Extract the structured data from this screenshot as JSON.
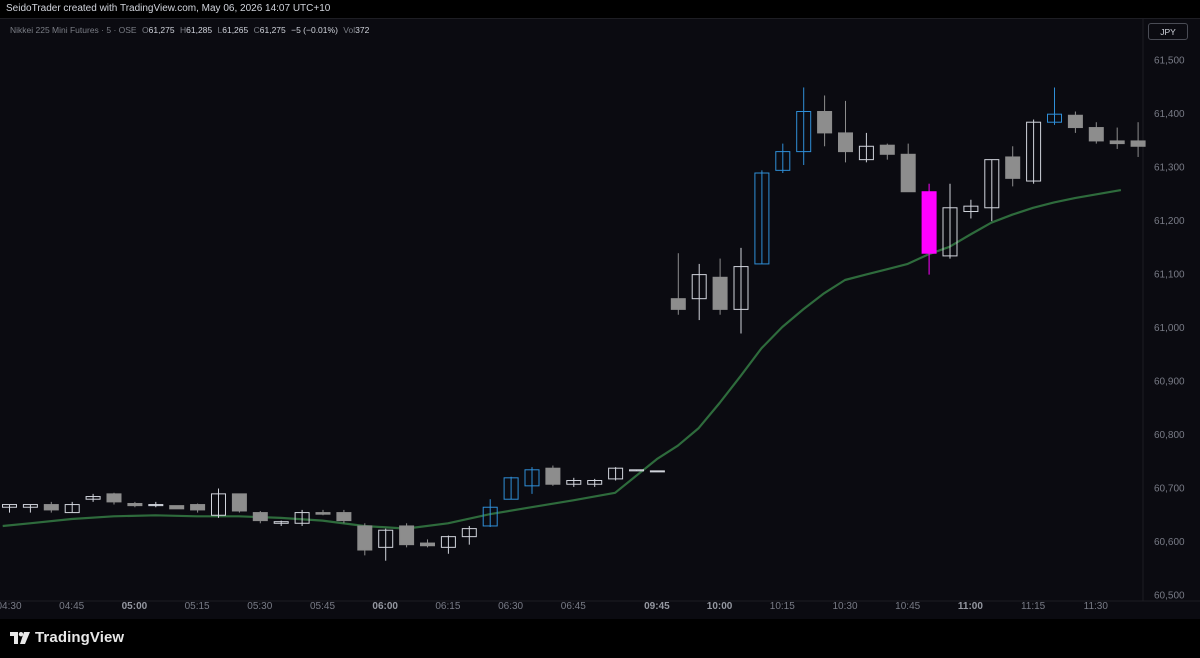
{
  "header": {
    "caption": "SeidoTrader created with TradingView.com, May 06, 2026 14:07 UTC+10"
  },
  "legend": {
    "symbol": "Nikkei 225 Mini Futures · 5 · OSE",
    "o_label": "O",
    "o_value": "61,275",
    "h_label": "H",
    "h_value": "61,285",
    "l_label": "L",
    "l_value": "61,265",
    "c_label": "C",
    "c_value": "61,275",
    "change": "−5 (−0.01%)",
    "vol_label": "Vol",
    "vol_value": "372"
  },
  "currency_button": "JPY",
  "footer": {
    "brand": "TradingView"
  },
  "colors": {
    "background": "#0b0b11",
    "bull_outline": "#d1d4dc",
    "bear_fill": "#8d8d8d",
    "blue_outline": "#2f8fd8",
    "magenta": "#ff00ff",
    "moving_average": "#2e6b3c",
    "axis_text": "#787b86"
  },
  "chart_data": {
    "type": "candlestick",
    "symbol": "Nikkei 225 Mini Futures",
    "interval": "5",
    "exchange": "OSE",
    "y_ticks": [
      61500,
      61400,
      61300,
      61200,
      61100,
      61000,
      60900,
      60800,
      60700,
      60600,
      60500
    ],
    "y_tick_labels": [
      "61,500",
      "61,400",
      "61,300",
      "61,200",
      "61,100",
      "61,000",
      "60,900",
      "60,800",
      "60,700",
      "60,600",
      "60,500"
    ],
    "ylim": [
      60456,
      61578
    ],
    "x_ticks": [
      {
        "label": "04:30",
        "slot": 0,
        "bold": false
      },
      {
        "label": "04:45",
        "slot": 3,
        "bold": false
      },
      {
        "label": "05:00",
        "slot": 6,
        "bold": true
      },
      {
        "label": "05:15",
        "slot": 9,
        "bold": false
      },
      {
        "label": "05:30",
        "slot": 12,
        "bold": false
      },
      {
        "label": "05:45",
        "slot": 15,
        "bold": false
      },
      {
        "label": "06:00",
        "slot": 18,
        "bold": true
      },
      {
        "label": "06:15",
        "slot": 21,
        "bold": false
      },
      {
        "label": "06:30",
        "slot": 24,
        "bold": false
      },
      {
        "label": "06:45",
        "slot": 27,
        "bold": false
      },
      {
        "label": "09:45",
        "slot": 31,
        "bold": true
      },
      {
        "label": "10:00",
        "slot": 34,
        "bold": true
      },
      {
        "label": "10:15",
        "slot": 37,
        "bold": false
      },
      {
        "label": "10:30",
        "slot": 40,
        "bold": false
      },
      {
        "label": "10:45",
        "slot": 43,
        "bold": false
      },
      {
        "label": "11:00",
        "slot": 46,
        "bold": true
      },
      {
        "label": "11:15",
        "slot": 49,
        "bold": false
      },
      {
        "label": "11:30",
        "slot": 52,
        "bold": false
      }
    ],
    "candles": [
      {
        "o": 60665,
        "h": 60670,
        "l": 60655,
        "c": 60670,
        "style": "bull"
      },
      {
        "o": 60665,
        "h": 60670,
        "l": 60655,
        "c": 60670,
        "style": "bull"
      },
      {
        "o": 60670,
        "h": 60675,
        "l": 60655,
        "c": 60660,
        "style": "bear"
      },
      {
        "o": 60655,
        "h": 60675,
        "l": 60655,
        "c": 60670,
        "style": "bull"
      },
      {
        "o": 60680,
        "h": 60690,
        "l": 60675,
        "c": 60685,
        "style": "bull"
      },
      {
        "o": 60690,
        "h": 60692,
        "l": 60670,
        "c": 60675,
        "style": "bear"
      },
      {
        "o": 60672,
        "h": 60675,
        "l": 60665,
        "c": 60668,
        "style": "bear"
      },
      {
        "o": 60668,
        "h": 60675,
        "l": 60665,
        "c": 60670,
        "style": "bull"
      },
      {
        "o": 60668,
        "h": 60668,
        "l": 60662,
        "c": 60662,
        "style": "bear"
      },
      {
        "o": 60670,
        "h": 60672,
        "l": 60655,
        "c": 60660,
        "style": "bear"
      },
      {
        "o": 60650,
        "h": 60700,
        "l": 60645,
        "c": 60690,
        "style": "bull"
      },
      {
        "o": 60690,
        "h": 60690,
        "l": 60655,
        "c": 60658,
        "style": "bear"
      },
      {
        "o": 60655,
        "h": 60658,
        "l": 60635,
        "c": 60640,
        "style": "bear"
      },
      {
        "o": 60635,
        "h": 60640,
        "l": 60630,
        "c": 60638,
        "style": "bull"
      },
      {
        "o": 60635,
        "h": 60660,
        "l": 60630,
        "c": 60655,
        "style": "bull"
      },
      {
        "o": 60655,
        "h": 60660,
        "l": 60650,
        "c": 60652,
        "style": "bear"
      },
      {
        "o": 60655,
        "h": 60660,
        "l": 60635,
        "c": 60640,
        "style": "bear"
      },
      {
        "o": 60630,
        "h": 60635,
        "l": 60575,
        "c": 60585,
        "style": "bear"
      },
      {
        "o": 60590,
        "h": 60625,
        "l": 60565,
        "c": 60622,
        "style": "bull"
      },
      {
        "o": 60630,
        "h": 60635,
        "l": 60590,
        "c": 60595,
        "style": "bear"
      },
      {
        "o": 60598,
        "h": 60605,
        "l": 60590,
        "c": 60593,
        "style": "bear"
      },
      {
        "o": 60590,
        "h": 60612,
        "l": 60578,
        "c": 60610,
        "style": "bull"
      },
      {
        "o": 60610,
        "h": 60630,
        "l": 60595,
        "c": 60625,
        "style": "bull"
      },
      {
        "o": 60630,
        "h": 60680,
        "l": 60628,
        "c": 60665,
        "style": "blue"
      },
      {
        "o": 60680,
        "h": 60722,
        "l": 60680,
        "c": 60720,
        "style": "blue"
      },
      {
        "o": 60705,
        "h": 60740,
        "l": 60690,
        "c": 60735,
        "style": "blue"
      },
      {
        "o": 60738,
        "h": 60743,
        "l": 60705,
        "c": 60708,
        "style": "bear"
      },
      {
        "o": 60708,
        "h": 60720,
        "l": 60703,
        "c": 60715,
        "style": "bull"
      },
      {
        "o": 60708,
        "h": 60718,
        "l": 60703,
        "c": 60715,
        "style": "bull"
      },
      {
        "o": 60718,
        "h": 60740,
        "l": 60715,
        "c": 60738,
        "style": "bull"
      },
      {
        "o": 60733,
        "h": 60735,
        "l": 60733,
        "c": 60735,
        "style": "bull"
      },
      {
        "o": 60733,
        "h": 60733,
        "l": 60733,
        "c": 60733,
        "style": "bull"
      },
      {
        "o": 61055,
        "h": 61140,
        "l": 61025,
        "c": 61035,
        "style": "bear"
      },
      {
        "o": 61055,
        "h": 61120,
        "l": 61015,
        "c": 61100,
        "style": "bull"
      },
      {
        "o": 61095,
        "h": 61130,
        "l": 61025,
        "c": 61035,
        "style": "bear"
      },
      {
        "o": 61035,
        "h": 61150,
        "l": 60990,
        "c": 61115,
        "style": "bull"
      },
      {
        "o": 61120,
        "h": 61295,
        "l": 61120,
        "c": 61290,
        "style": "blue"
      },
      {
        "o": 61295,
        "h": 61345,
        "l": 61290,
        "c": 61330,
        "style": "blue"
      },
      {
        "o": 61330,
        "h": 61450,
        "l": 61305,
        "c": 61405,
        "style": "blue"
      },
      {
        "o": 61405,
        "h": 61435,
        "l": 61340,
        "c": 61365,
        "style": "bear"
      },
      {
        "o": 61365,
        "h": 61425,
        "l": 61310,
        "c": 61330,
        "style": "bear"
      },
      {
        "o": 61315,
        "h": 61365,
        "l": 61310,
        "c": 61340,
        "style": "bull"
      },
      {
        "o": 61342,
        "h": 61345,
        "l": 61315,
        "c": 61325,
        "style": "bear"
      },
      {
        "o": 61325,
        "h": 61345,
        "l": 61255,
        "c": 61255,
        "style": "bear"
      },
      {
        "o": 61255,
        "h": 61270,
        "l": 61100,
        "c": 61140,
        "style": "magenta"
      },
      {
        "o": 61135,
        "h": 61270,
        "l": 61130,
        "c": 61225,
        "style": "bull"
      },
      {
        "o": 61218,
        "h": 61240,
        "l": 61205,
        "c": 61228,
        "style": "bull"
      },
      {
        "o": 61225,
        "h": 61315,
        "l": 61200,
        "c": 61315,
        "style": "bull"
      },
      {
        "o": 61320,
        "h": 61340,
        "l": 61265,
        "c": 61280,
        "style": "bear"
      },
      {
        "o": 61275,
        "h": 61390,
        "l": 61270,
        "c": 61385,
        "style": "bull"
      },
      {
        "o": 61385,
        "h": 61450,
        "l": 61380,
        "c": 61400,
        "style": "blue"
      },
      {
        "o": 61398,
        "h": 61405,
        "l": 61365,
        "c": 61375,
        "style": "bear"
      },
      {
        "o": 61375,
        "h": 61385,
        "l": 61345,
        "c": 61350,
        "style": "bear"
      },
      {
        "o": 61350,
        "h": 61375,
        "l": 61335,
        "c": 61345,
        "style": "bear"
      },
      {
        "o": 61350,
        "h": 61385,
        "l": 61320,
        "c": 61340,
        "style": "bear"
      }
    ],
    "moving_average": {
      "color": "#2e6b3c",
      "slots": [
        -0.3,
        1,
        3,
        5,
        7,
        9,
        11,
        13,
        15,
        17,
        19,
        21,
        23,
        25,
        27,
        29,
        31,
        32,
        33,
        34,
        35,
        36,
        37,
        38,
        39,
        40,
        41,
        42,
        43,
        44,
        45,
        46,
        47,
        48,
        49,
        50,
        51,
        52,
        53.2
      ],
      "values": [
        60630,
        60635,
        60643,
        60648,
        60650,
        60648,
        60648,
        60645,
        60640,
        60630,
        60625,
        60635,
        60652,
        60665,
        60678,
        60692,
        60755,
        60780,
        60813,
        60860,
        60910,
        60962,
        61002,
        61035,
        61065,
        61090,
        61100,
        61110,
        61120,
        61138,
        61152,
        61175,
        61197,
        61212,
        61225,
        61235,
        61243,
        61250,
        61258
      ]
    }
  }
}
